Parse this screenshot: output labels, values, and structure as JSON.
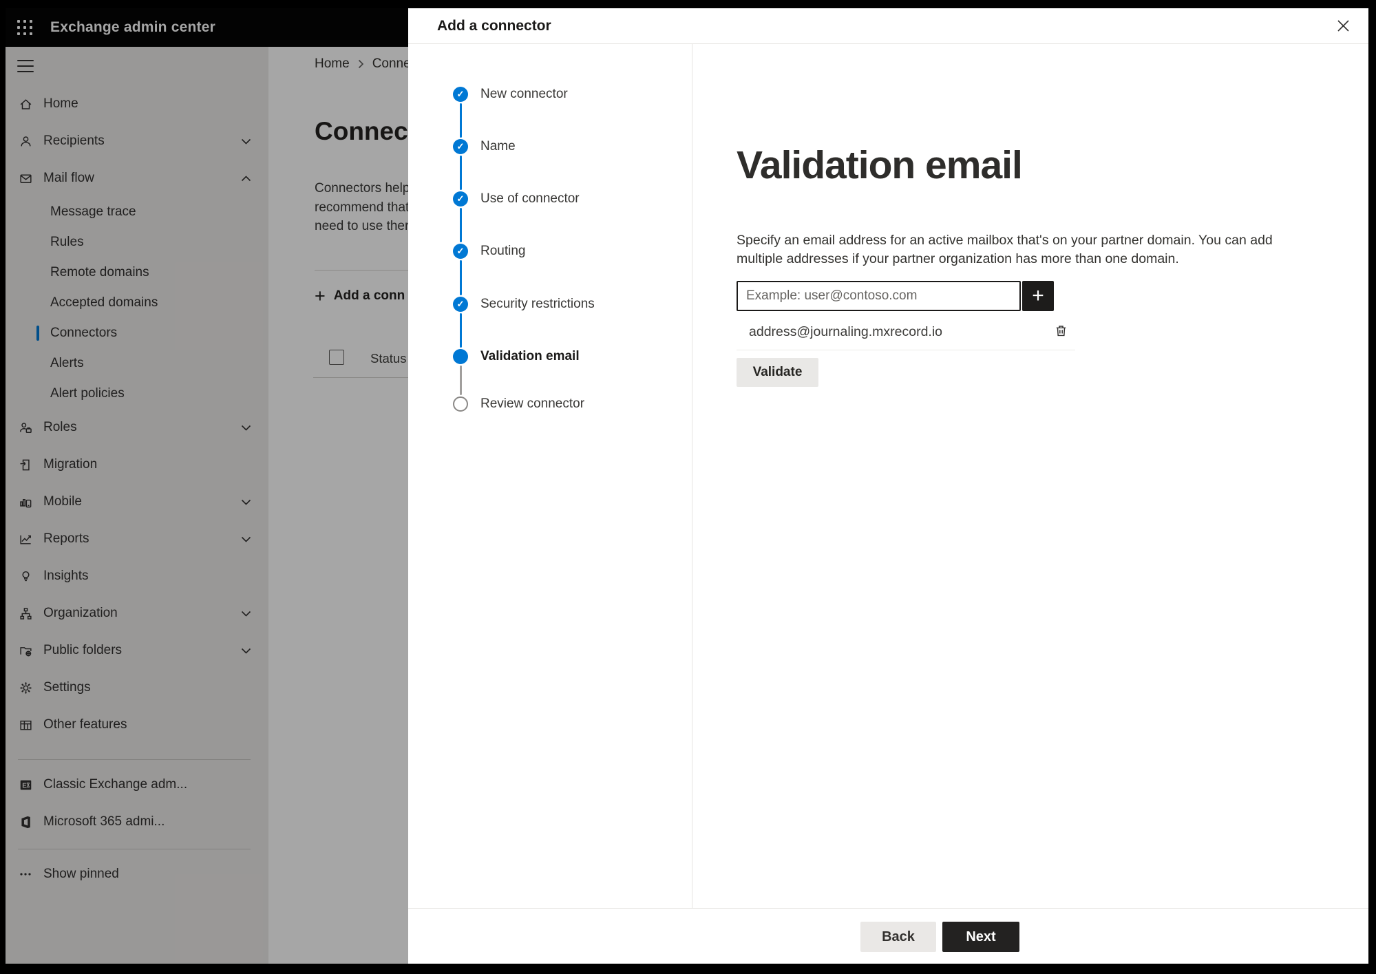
{
  "app": {
    "title": "Exchange admin center"
  },
  "sidebar": {
    "items": [
      {
        "label": "Home",
        "icon": "home",
        "level": "top"
      },
      {
        "label": "Recipients",
        "icon": "person",
        "level": "top",
        "chevron": "down"
      },
      {
        "label": "Mail flow",
        "icon": "mail",
        "level": "top",
        "chevron": "up"
      },
      {
        "label": "Message trace",
        "level": "sub"
      },
      {
        "label": "Rules",
        "level": "sub"
      },
      {
        "label": "Remote domains",
        "level": "sub"
      },
      {
        "label": "Accepted domains",
        "level": "sub"
      },
      {
        "label": "Connectors",
        "level": "sub",
        "selected": true
      },
      {
        "label": "Alerts",
        "level": "sub"
      },
      {
        "label": "Alert policies",
        "level": "sub"
      },
      {
        "label": "Roles",
        "icon": "roles",
        "level": "top",
        "chevron": "down"
      },
      {
        "label": "Migration",
        "icon": "migration",
        "level": "top"
      },
      {
        "label": "Mobile",
        "icon": "mobile",
        "level": "top",
        "chevron": "down"
      },
      {
        "label": "Reports",
        "icon": "reports",
        "level": "top",
        "chevron": "down"
      },
      {
        "label": "Insights",
        "icon": "insights",
        "level": "top"
      },
      {
        "label": "Organization",
        "icon": "org",
        "level": "top",
        "chevron": "down"
      },
      {
        "label": "Public folders",
        "icon": "folders",
        "level": "top",
        "chevron": "down"
      },
      {
        "label": "Settings",
        "icon": "gear",
        "level": "top"
      },
      {
        "label": "Other features",
        "icon": "table",
        "level": "top"
      }
    ],
    "footer_items": [
      {
        "label": "Classic Exchange adm...",
        "icon": "exchange"
      },
      {
        "label": "Microsoft 365 admi...",
        "icon": "m365"
      }
    ],
    "pinned": {
      "label": "Show pinned"
    }
  },
  "page": {
    "breadcrumb": {
      "home": "Home",
      "current": "Conne"
    },
    "title": "Connec",
    "intro_lines": [
      "Connectors help",
      "recommend that",
      "need to use ther"
    ],
    "add_button": "Add a conn",
    "table": {
      "status_header": "Status"
    }
  },
  "modal": {
    "title": "Add a connector",
    "steps": [
      {
        "label": "New connector",
        "state": "done"
      },
      {
        "label": "Name",
        "state": "done"
      },
      {
        "label": "Use of connector",
        "state": "done"
      },
      {
        "label": "Routing",
        "state": "done"
      },
      {
        "label": "Security restrictions",
        "state": "done"
      },
      {
        "label": "Validation email",
        "state": "active"
      },
      {
        "label": "Review connector",
        "state": "todo"
      }
    ],
    "content": {
      "heading": "Validation email",
      "description": "Specify an email address for an active mailbox that's on your partner domain. You can add multiple addresses if your partner organization has more than one domain.",
      "email_placeholder": "Example: user@contoso.com",
      "addresses": [
        "address@journaling.mxrecord.io"
      ],
      "validate_label": "Validate"
    },
    "footer": {
      "back_label": "Back",
      "next_label": "Next"
    }
  },
  "colors": {
    "accent": "#0078d4",
    "header_bg": "#060606",
    "dark_button": "#232221"
  }
}
